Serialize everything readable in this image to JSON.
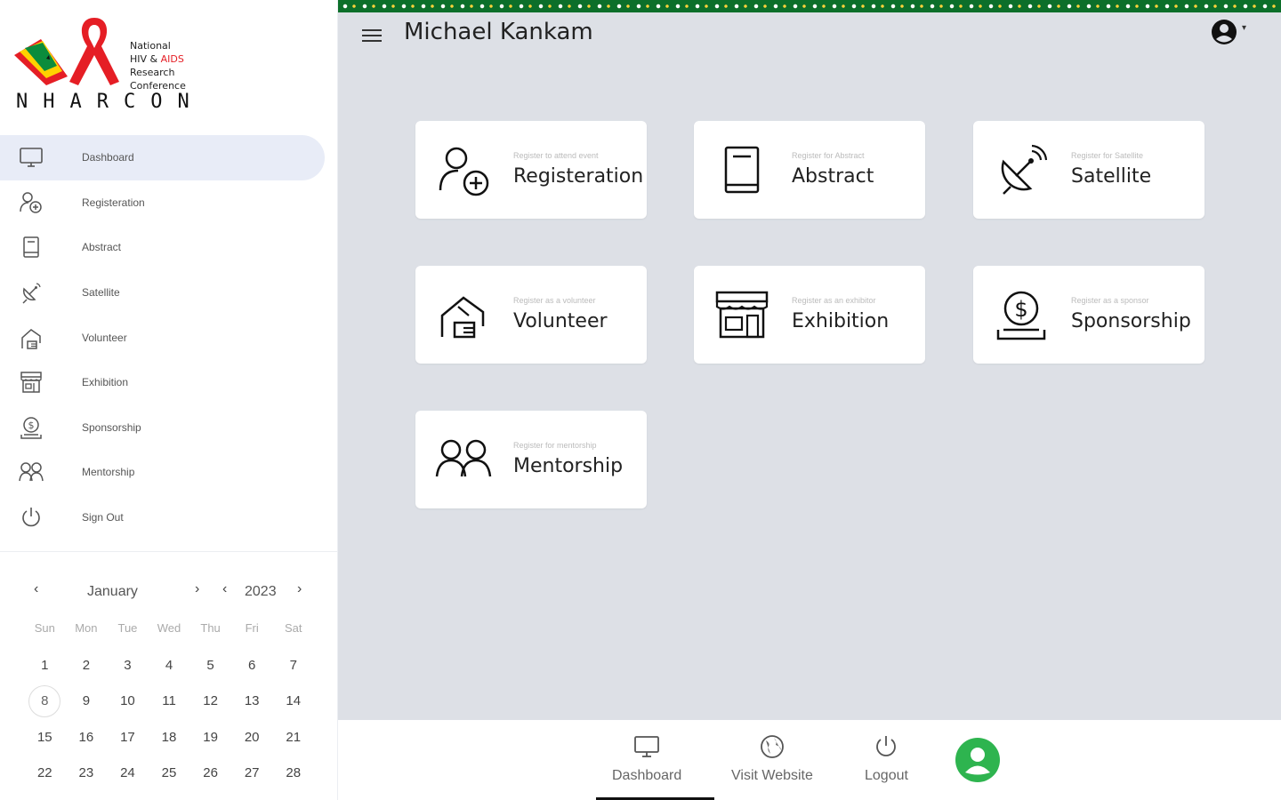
{
  "logo": {
    "line1": "National",
    "line2_a": "HIV & ",
    "line2_b": "AIDS",
    "line3": "Research",
    "line4": "Conference",
    "wordmark": "NHARCON"
  },
  "sidebar": {
    "items": [
      {
        "label": "Dashboard",
        "icon": "monitor-icon",
        "active": true
      },
      {
        "label": "Registeration",
        "icon": "user-add-icon"
      },
      {
        "label": "Abstract",
        "icon": "book-icon"
      },
      {
        "label": "Satellite",
        "icon": "satellite-dish-icon"
      },
      {
        "label": "Volunteer",
        "icon": "hand-house-icon"
      },
      {
        "label": "Exhibition",
        "icon": "storefront-icon"
      },
      {
        "label": "Sponsorship",
        "icon": "dollar-coin-icon"
      },
      {
        "label": "Mentorship",
        "icon": "two-people-icon"
      },
      {
        "label": "Sign Out",
        "icon": "power-icon"
      }
    ]
  },
  "calendar": {
    "month": "January",
    "year": "2023",
    "prev_month": "‹",
    "next_month": "›",
    "prev_year": "‹",
    "next_year": "›",
    "weekdays": [
      "Sun",
      "Mon",
      "Tue",
      "Wed",
      "Thu",
      "Fri",
      "Sat"
    ],
    "weeks": [
      [
        "1",
        "2",
        "3",
        "4",
        "5",
        "6",
        "7"
      ],
      [
        "8",
        "9",
        "10",
        "11",
        "12",
        "13",
        "14"
      ],
      [
        "15",
        "16",
        "17",
        "18",
        "19",
        "20",
        "21"
      ],
      [
        "22",
        "23",
        "24",
        "25",
        "26",
        "27",
        "28"
      ]
    ],
    "today": "8"
  },
  "header": {
    "user_name": "Michael Kankam",
    "account_caret": "▾"
  },
  "cards": [
    {
      "title": "Registeration",
      "subtitle": "Register to attend event",
      "icon": "user-add-icon"
    },
    {
      "title": "Abstract",
      "subtitle": "Register for Abstract",
      "icon": "book-icon"
    },
    {
      "title": "Satellite",
      "subtitle": "Register for Satellite",
      "icon": "satellite-dish-icon"
    },
    {
      "title": "Volunteer",
      "subtitle": "Register as a volunteer",
      "icon": "hand-house-icon"
    },
    {
      "title": "Exhibition",
      "subtitle": "Register as an exhibitor",
      "icon": "storefront-icon"
    },
    {
      "title": "Sponsorship",
      "subtitle": "Register as a sponsor",
      "icon": "dollar-coin-icon"
    },
    {
      "title": "Mentorship",
      "subtitle": "Register for mentorship",
      "icon": "two-people-icon"
    }
  ],
  "bottom_nav": {
    "dashboard": "Dashboard",
    "visit_website": "Visit Website",
    "logout": "Logout"
  },
  "colors": {
    "accent_active": "#e8ecf7",
    "main_bg": "#dde0e6",
    "ribbon_red": "#e51e25",
    "kente_green": "#0c6f2a",
    "avatar_green": "#2eb44f"
  }
}
